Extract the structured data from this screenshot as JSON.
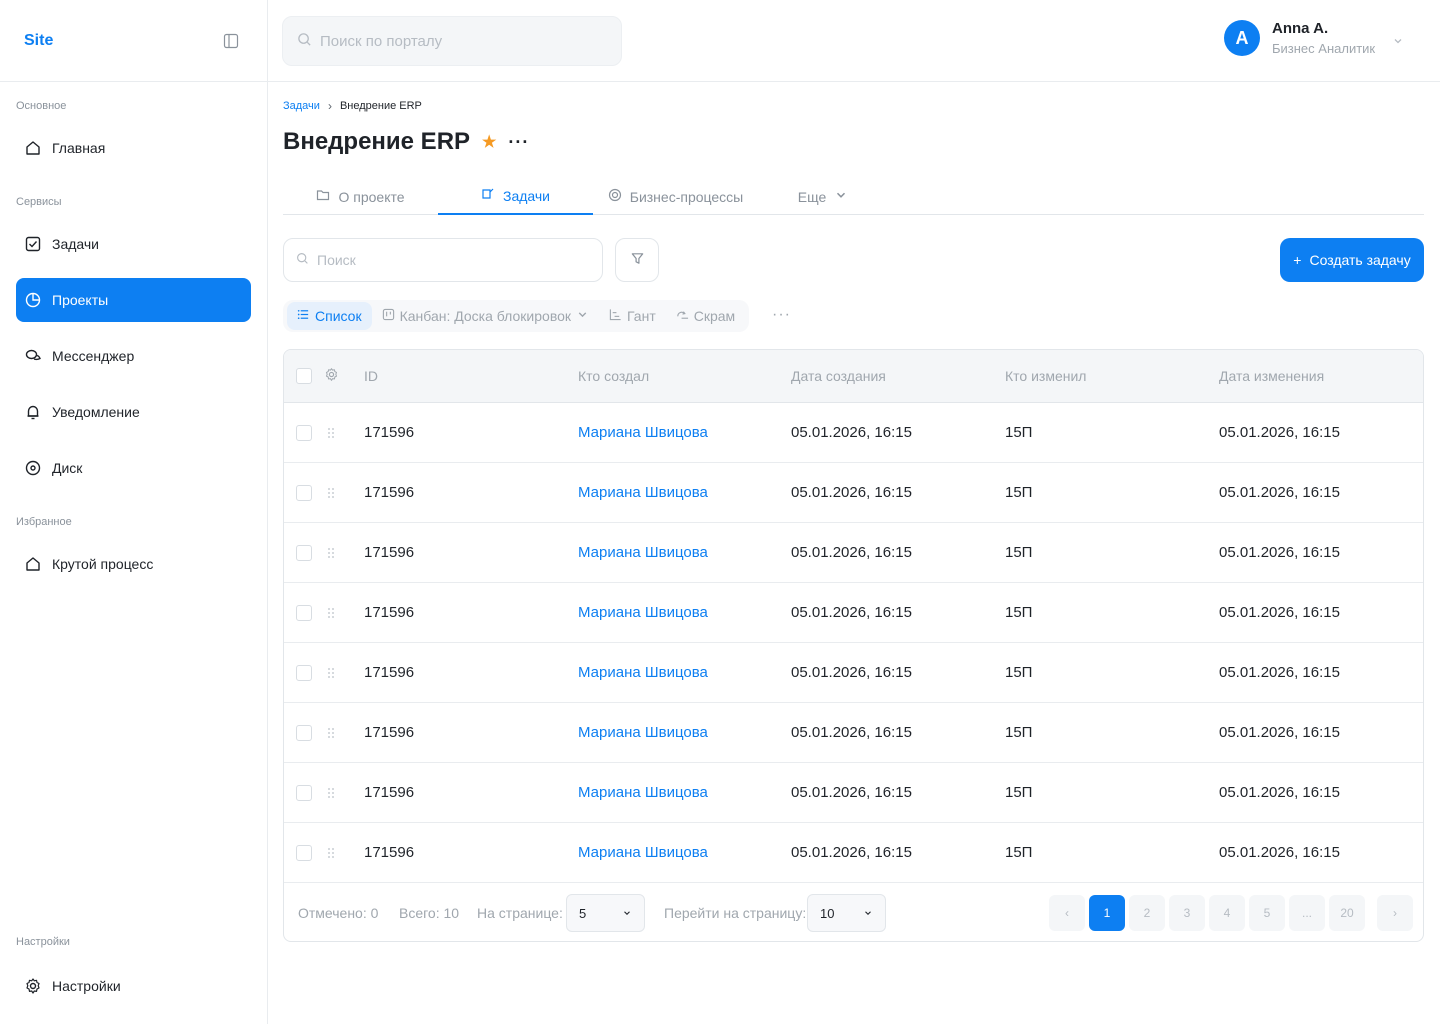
{
  "sidebar": {
    "logo": "Site",
    "sections": {
      "main": "Основное",
      "services": "Сервисы",
      "favorites": "Избранное",
      "settings": "Настройки"
    },
    "items": [
      {
        "label": "Главная"
      },
      {
        "label": "Задачи"
      },
      {
        "label": "Проекты"
      },
      {
        "label": "Мессенджер"
      },
      {
        "label": "Уведомление"
      },
      {
        "label": "Диск"
      },
      {
        "label": "Крутой процесс"
      },
      {
        "label": "Настройки"
      }
    ]
  },
  "header": {
    "search_placeholder": "Поиск по порталу",
    "user": {
      "initial": "A",
      "name": "Anna A.",
      "role": "Бизнес Аналитик"
    }
  },
  "breadcrumb": {
    "parent": "Задачи",
    "separator": "›",
    "current": "Внедрение ERP"
  },
  "page": {
    "title": "Внедрение ERP",
    "star": "★",
    "more": "···"
  },
  "tabs": [
    {
      "label": "О проекте"
    },
    {
      "label": "Задачи"
    },
    {
      "label": "Бизнес-процессы"
    },
    {
      "label": "Еще"
    }
  ],
  "toolbar": {
    "search_placeholder": "Поиск",
    "create_label": "Создать задачу",
    "create_plus": "+"
  },
  "views": [
    {
      "label": "Список"
    },
    {
      "label": "Канбан: Доска блокировок"
    },
    {
      "label": "Гант"
    },
    {
      "label": "Скрам"
    }
  ],
  "views_more": "···",
  "table": {
    "columns": [
      "ID",
      "Кто создал",
      "Дата создания",
      "Кто изменил",
      "Дата изменения"
    ],
    "rows": [
      {
        "id": "171596",
        "creator": "Мариана Швицова",
        "created": "05.01.2026, 16:15",
        "modifier": "15П",
        "modified": "05.01.2026, 16:15"
      },
      {
        "id": "171596",
        "creator": "Мариана Швицова",
        "created": "05.01.2026, 16:15",
        "modifier": "15П",
        "modified": "05.01.2026, 16:15"
      },
      {
        "id": "171596",
        "creator": "Мариана Швицова",
        "created": "05.01.2026, 16:15",
        "modifier": "15П",
        "modified": "05.01.2026, 16:15"
      },
      {
        "id": "171596",
        "creator": "Мариана Швицова",
        "created": "05.01.2026, 16:15",
        "modifier": "15П",
        "modified": "05.01.2026, 16:15"
      },
      {
        "id": "171596",
        "creator": "Мариана Швицова",
        "created": "05.01.2026, 16:15",
        "modifier": "15П",
        "modified": "05.01.2026, 16:15"
      },
      {
        "id": "171596",
        "creator": "Мариана Швицова",
        "created": "05.01.2026, 16:15",
        "modifier": "15П",
        "modified": "05.01.2026, 16:15"
      },
      {
        "id": "171596",
        "creator": "Мариана Швицова",
        "created": "05.01.2026, 16:15",
        "modifier": "15П",
        "modified": "05.01.2026, 16:15"
      },
      {
        "id": "171596",
        "creator": "Мариана Швицова",
        "created": "05.01.2026, 16:15",
        "modifier": "15П",
        "modified": "05.01.2026, 16:15"
      }
    ]
  },
  "footer": {
    "selected": "Отмечено: 0",
    "total": "Всего: 10",
    "per_page_label": "На странице:",
    "per_page_value": "5",
    "goto_label": "Перейти на страницу:",
    "goto_value": "10",
    "pages": [
      "1",
      "2",
      "3",
      "4",
      "5",
      "...",
      "20"
    ],
    "current_page": "1",
    "prev": "‹",
    "next": "›"
  },
  "colors": {
    "accent": "#0d7ff2",
    "star": "#f59a23"
  }
}
